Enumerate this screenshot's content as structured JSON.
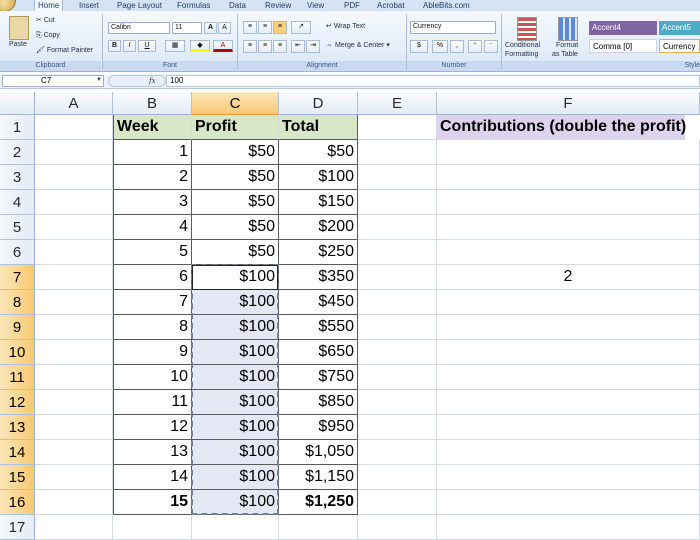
{
  "ribbon": {
    "tabs": [
      "Home",
      "Insert",
      "Page Layout",
      "Formulas",
      "Data",
      "Review",
      "View",
      "PDF",
      "Acrobat",
      "AbleBits.com"
    ],
    "active_tab": "Home",
    "clipboard": {
      "paste": "Paste",
      "cut": "Cut",
      "copy": "Copy",
      "format_painter": "Format Painter",
      "label": "Clipboard"
    },
    "font": {
      "name": "Calibri",
      "size": "11",
      "label": "Font",
      "bold": "B",
      "italic": "I",
      "underline": "U",
      "grow": "A",
      "shrink": "A",
      "font_color": "A"
    },
    "alignment": {
      "wrap_text": "Wrap Text",
      "merge_center": "Merge & Center",
      "label": "Alignment"
    },
    "number": {
      "format": "Currency",
      "currency": "$",
      "percent": "%",
      "comma": ",",
      "label": "Number"
    },
    "styles": {
      "conditional": "Conditional",
      "conditional2": "Formatting",
      "format_as": "Format",
      "format_as2": "as Table",
      "accent4": "Accent4",
      "accent5": "Accent5",
      "comma0": "Comma [0]",
      "currency": "Currency",
      "label": "Style",
      "colors": {
        "accent4": "#8064a2",
        "accent5": "#4bacc6"
      }
    }
  },
  "formula_bar": {
    "name_box": "C7",
    "fx": "fx",
    "formula": "100"
  },
  "columns": [
    "A",
    "B",
    "C",
    "D",
    "E",
    "F"
  ],
  "rows": [
    "1",
    "2",
    "3",
    "4",
    "5",
    "6",
    "7",
    "8",
    "9",
    "10",
    "11",
    "12",
    "13",
    "14",
    "15",
    "16",
    "17"
  ],
  "headers": {
    "week": "Week",
    "profit": "Profit",
    "total": "Total",
    "contributions": "Contributions (double the profit)"
  },
  "table": [
    {
      "week": "1",
      "profit": "$50",
      "total": "$50"
    },
    {
      "week": "2",
      "profit": "$50",
      "total": "$100"
    },
    {
      "week": "3",
      "profit": "$50",
      "total": "$150"
    },
    {
      "week": "4",
      "profit": "$50",
      "total": "$200"
    },
    {
      "week": "5",
      "profit": "$50",
      "total": "$250"
    },
    {
      "week": "6",
      "profit": "$100",
      "total": "$350"
    },
    {
      "week": "7",
      "profit": "$100",
      "total": "$450"
    },
    {
      "week": "8",
      "profit": "$100",
      "total": "$550"
    },
    {
      "week": "9",
      "profit": "$100",
      "total": "$650"
    },
    {
      "week": "10",
      "profit": "$100",
      "total": "$750"
    },
    {
      "week": "11",
      "profit": "$100",
      "total": "$850"
    },
    {
      "week": "12",
      "profit": "$100",
      "total": "$950"
    },
    {
      "week": "13",
      "profit": "$100",
      "total": "$1,050"
    },
    {
      "week": "14",
      "profit": "$100",
      "total": "$1,150"
    },
    {
      "week": "15",
      "profit": "$100",
      "total": "$1,250"
    }
  ],
  "f7_value": "2",
  "selected_cell": "C7",
  "colors": {
    "header_green": "#d6e6c6",
    "header_purple": "#ddd3ec",
    "selection": "#f7c873"
  }
}
